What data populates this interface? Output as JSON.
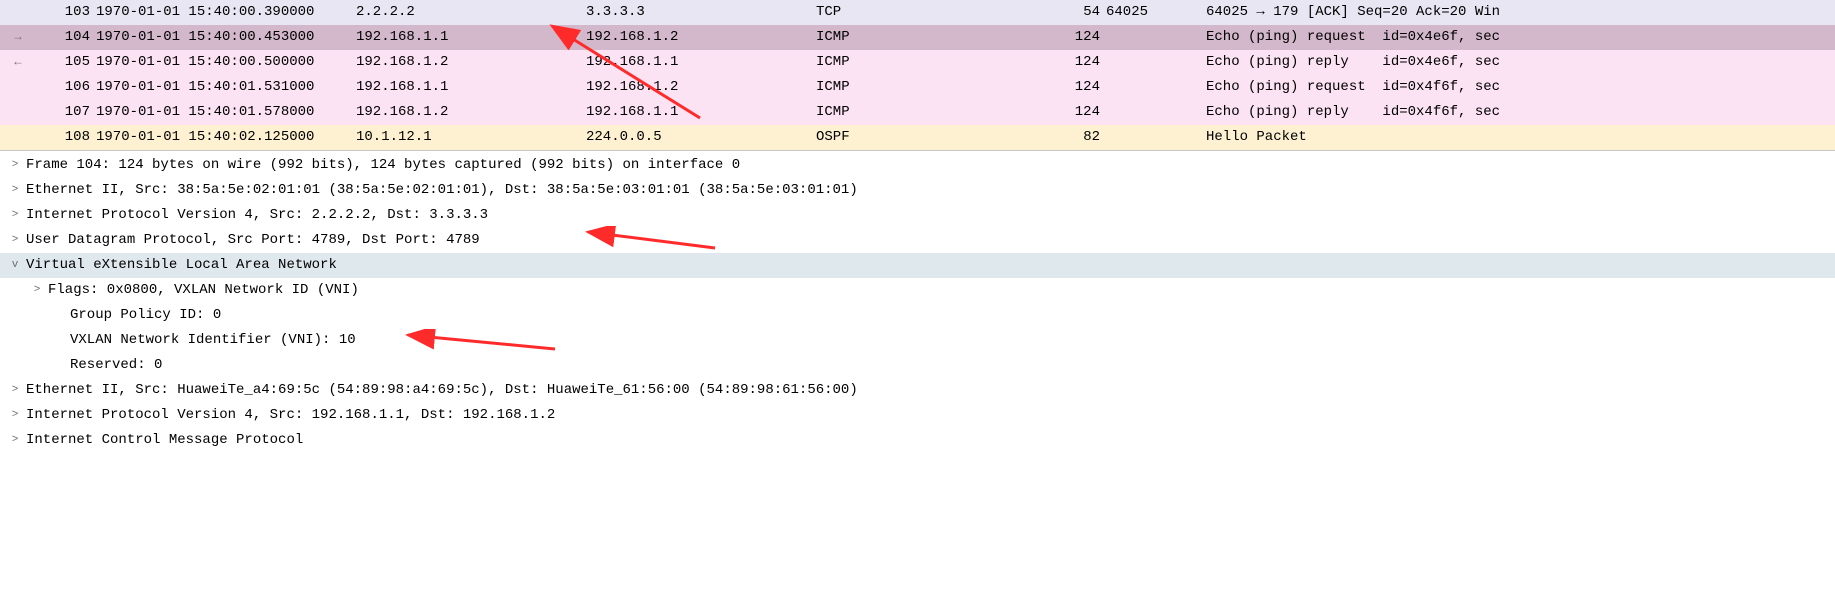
{
  "packets": [
    {
      "mark": "",
      "no": "103",
      "time": "1970-01-01 15:40:00.390000",
      "src": "2.2.2.2",
      "dst": "3.3.3.3",
      "proto": "TCP",
      "len": "54",
      "port": "64025",
      "info": "64025 → 179 [ACK] Seq=20 Ack=20 Win",
      "bg": "bg-tcp"
    },
    {
      "mark": "→",
      "no": "104",
      "time": "1970-01-01 15:40:00.453000",
      "src": "192.168.1.1",
      "dst": "192.168.1.2",
      "proto": "ICMP",
      "len": "124",
      "port": "",
      "info": "Echo (ping) request  id=0x4e6f, sec",
      "bg": "bg-sel"
    },
    {
      "mark": "←",
      "no": "105",
      "time": "1970-01-01 15:40:00.500000",
      "src": "192.168.1.2",
      "dst": "192.168.1.1",
      "proto": "ICMP",
      "len": "124",
      "port": "",
      "info": "Echo (ping) reply    id=0x4e6f, sec",
      "bg": "bg-icmp"
    },
    {
      "mark": "",
      "no": "106",
      "time": "1970-01-01 15:40:01.531000",
      "src": "192.168.1.1",
      "dst": "192.168.1.2",
      "proto": "ICMP",
      "len": "124",
      "port": "",
      "info": "Echo (ping) request  id=0x4f6f, sec",
      "bg": "bg-icmp"
    },
    {
      "mark": "",
      "no": "107",
      "time": "1970-01-01 15:40:01.578000",
      "src": "192.168.1.2",
      "dst": "192.168.1.1",
      "proto": "ICMP",
      "len": "124",
      "port": "",
      "info": "Echo (ping) reply    id=0x4f6f, sec",
      "bg": "bg-icmp"
    },
    {
      "mark": "",
      "no": "108",
      "time": "1970-01-01 15:40:02.125000",
      "src": "10.1.12.1",
      "dst": "224.0.0.5",
      "proto": "OSPF",
      "len": "82",
      "port": "",
      "info": "Hello Packet",
      "bg": "bg-ospf"
    }
  ],
  "details": [
    {
      "toggle": ">",
      "indent": 0,
      "hl": false,
      "text": "Frame 104: 124 bytes on wire (992 bits), 124 bytes captured (992 bits) on interface 0"
    },
    {
      "toggle": ">",
      "indent": 0,
      "hl": false,
      "text": "Ethernet II, Src: 38:5a:5e:02:01:01 (38:5a:5e:02:01:01), Dst: 38:5a:5e:03:01:01 (38:5a:5e:03:01:01)"
    },
    {
      "toggle": ">",
      "indent": 0,
      "hl": false,
      "text": "Internet Protocol Version 4, Src: 2.2.2.2, Dst: 3.3.3.3"
    },
    {
      "toggle": ">",
      "indent": 0,
      "hl": false,
      "text": "User Datagram Protocol, Src Port: 4789, Dst Port: 4789"
    },
    {
      "toggle": "v",
      "indent": 0,
      "hl": true,
      "text": "Virtual eXtensible Local Area Network"
    },
    {
      "toggle": ">",
      "indent": 1,
      "hl": false,
      "text": "Flags: 0x0800, VXLAN Network ID (VNI)"
    },
    {
      "toggle": "",
      "indent": 2,
      "hl": false,
      "text": "Group Policy ID: 0"
    },
    {
      "toggle": "",
      "indent": 2,
      "hl": false,
      "text": "VXLAN Network Identifier (VNI): 10"
    },
    {
      "toggle": "",
      "indent": 2,
      "hl": false,
      "text": "Reserved: 0"
    },
    {
      "toggle": ">",
      "indent": 0,
      "hl": false,
      "text": "Ethernet II, Src: HuaweiTe_a4:69:5c (54:89:98:a4:69:5c), Dst: HuaweiTe_61:56:00 (54:89:98:61:56:00)"
    },
    {
      "toggle": ">",
      "indent": 0,
      "hl": false,
      "text": "Internet Protocol Version 4, Src: 192.168.1.1, Dst: 192.168.1.2"
    },
    {
      "toggle": ">",
      "indent": 0,
      "hl": false,
      "text": "Internet Control Message Protocol"
    }
  ]
}
